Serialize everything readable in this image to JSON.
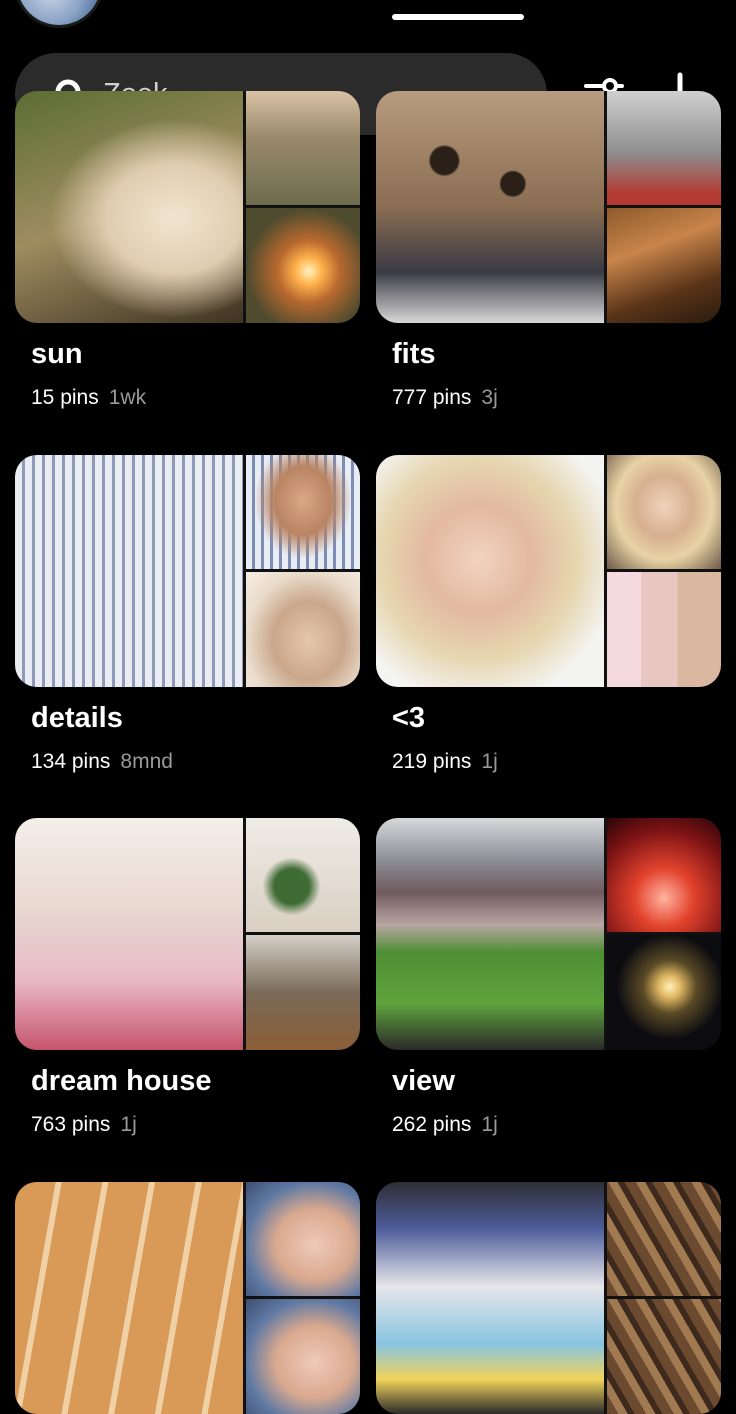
{
  "search": {
    "placeholder": "Zoek"
  },
  "header": {
    "filter_icon": "sliders-icon",
    "add_icon": "plus-icon"
  },
  "boards": [
    {
      "title": "sun",
      "pins": "15 pins",
      "age": "1wk"
    },
    {
      "title": "fits",
      "pins": "777 pins",
      "age": "3j"
    },
    {
      "title": "details",
      "pins": "134 pins",
      "age": "8mnd"
    },
    {
      "title": "<3",
      "pins": "219 pins",
      "age": "1j"
    },
    {
      "title": "dream house",
      "pins": "763 pins",
      "age": "1j"
    },
    {
      "title": "view",
      "pins": "262 pins",
      "age": "1j"
    }
  ]
}
